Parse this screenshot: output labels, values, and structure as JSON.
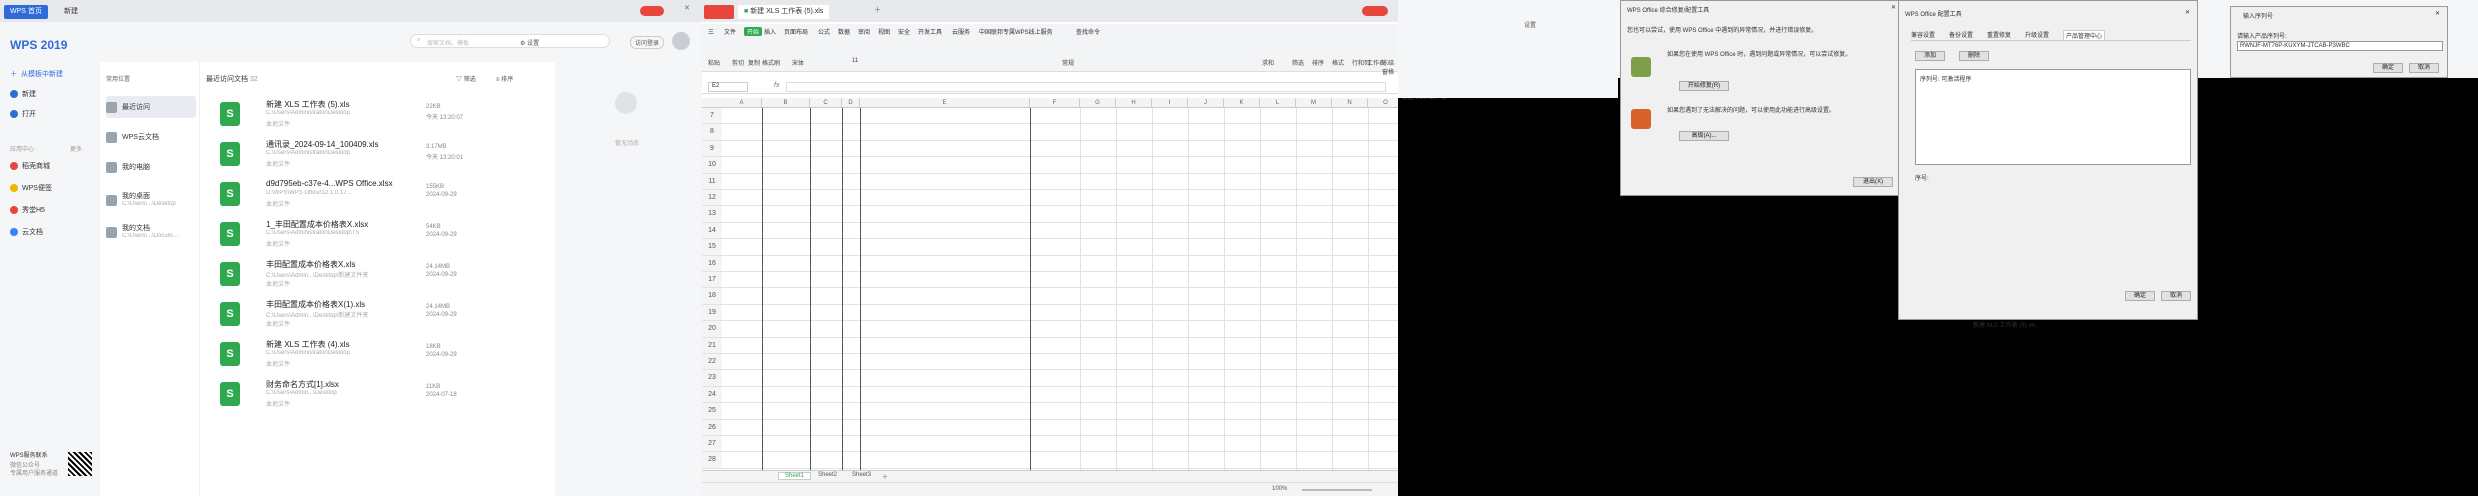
{
  "home": {
    "tabs": [
      "WPS 首页",
      "新建"
    ],
    "logo": "WPS 2019",
    "search_placeholder": "搜索文档、模板",
    "settings": "设置",
    "user_btn": "访问登录",
    "new_btn": "新建",
    "open_btn": "打开",
    "nav_top": "从模板中新建",
    "nav_label": "应用中心",
    "nav_more": "更多",
    "nav": [
      {
        "label": "稻壳商城",
        "color": "#e8453c"
      },
      {
        "label": "WPS便签",
        "color": "#f5b400"
      },
      {
        "label": "秀堂H5",
        "color": "#e8453c"
      },
      {
        "label": "云文档",
        "color": "#3b82f6"
      }
    ],
    "promo_title": "WPS服务联系",
    "promo_sub": "微信公众号",
    "promo_sub2": "专属用户服务通道",
    "mid_header": "常用位置",
    "mid_items": [
      "最近访问",
      "WPS云文档",
      "我的电脑",
      "我的桌面",
      "我的文档"
    ],
    "mid_sub": [
      "",
      "",
      "",
      "C:\\Users\\...\\Desktop",
      "C:\\Users\\...\\Documents"
    ],
    "list_header": "最近访问文档",
    "list_count": "32",
    "tool_filter": "筛选",
    "tool_sort": "排序",
    "empty_text": "暂无动态",
    "files": [
      {
        "name": "新建 XLS 工作表 (5).xls",
        "path": "C:\\Users\\Administrator\\Desktop",
        "meta": "本地文件",
        "size": "22KB",
        "date": "今天 13:20:07"
      },
      {
        "name": "通讯录_2024-09-14_100409.xls",
        "path": "C:\\Users\\Administrator\\Desktop",
        "meta": "本地文件",
        "size": "3.17MB",
        "date": "今天 13:20:01"
      },
      {
        "name": "d9d795eb-c37e-4...WPS Office.xlsx",
        "path": "D:\\WPS\\WPS Office\\12.1.0.17...",
        "meta": "本地文件",
        "size": "155KB",
        "date": "2024-09-29"
      },
      {
        "name": "1_丰田配置成本价格表X.xlsx",
        "path": "C:\\Users\\Administrator\\Desktop\\TS",
        "meta": "本地文件",
        "size": "54KB",
        "date": "2024-09-29"
      },
      {
        "name": "丰田配置成本价格表X.xls",
        "path": "C:\\Users\\Admin...\\Desktop\\新建文件夹",
        "meta": "本地文件",
        "size": "24.14MB",
        "date": "2024-09-29"
      },
      {
        "name": "丰田配置成本价格表X(1).xls",
        "path": "C:\\Users\\Admin...\\Desktop\\新建文件夹",
        "meta": "本地文件",
        "size": "24.14MB",
        "date": "2024-09-29"
      },
      {
        "name": "新建 XLS 工作表 (4).xls",
        "path": "C:\\Users\\Administrator\\Desktop",
        "meta": "本地文件",
        "size": "18KB",
        "date": "2024-09-29"
      },
      {
        "name": "财务命名方式[1].xlsx",
        "path": "C:\\Users\\Admin...\\Desktop",
        "meta": "本地文件",
        "size": "11KB",
        "date": "2024-07-18"
      }
    ]
  },
  "sheet": {
    "tabs": [
      "新建 XLS 工作表 (5).xls"
    ],
    "menu": [
      "三",
      "文件",
      "开始",
      "插入",
      "页面布局",
      "公式",
      "数据",
      "审阅",
      "视图",
      "安全",
      "开发工具",
      "云服务",
      "中国联邦专属WPS线上服务",
      "查找命令"
    ],
    "ribbon_groups": [
      "粘贴",
      "剪切",
      "复制",
      "格式刷",
      "宋体",
      "11",
      "常规",
      "求和",
      "筛选",
      "排序",
      "格式",
      "行和列",
      "工作表",
      "冻结窗格"
    ],
    "name_box": "E2",
    "fx": "fx",
    "columns": [
      "A",
      "B",
      "C",
      "D",
      "E",
      "F",
      "G",
      "H",
      "I",
      "J",
      "K",
      "L",
      "M",
      "N",
      "O"
    ],
    "rows": [
      "7",
      "8",
      "9",
      "10",
      "11",
      "12",
      "13",
      "14",
      "15",
      "16",
      "17",
      "18",
      "19",
      "20",
      "21",
      "22",
      "23",
      "24",
      "25",
      "26",
      "27",
      "28"
    ],
    "sheets": [
      "Sheet1",
      "Sheet2",
      "Sheet3"
    ],
    "zoom": "100%"
  },
  "dialogs": {
    "bg_title": "新建 XLS 工作表",
    "bg_settings": "设置",
    "repair": {
      "title": "WPS Office 综合修复/配置工具",
      "intro": "您也可以尝试，使用 WPS Office 中遇到的异常情况，并进行错误修复。",
      "text1": "如果您在使用 WPS Office 时，遇到问题或异常情况，可以尝试修复。",
      "btn1": "开始修复(R)",
      "text2": "如果您遇到了无法解决的问题，可以使用此功能进行高级设置。",
      "btn2": "高级(A)...",
      "exit": "退出(X)"
    },
    "config": {
      "title": "WPS Office 配置工具",
      "tabs": [
        "兼容设置",
        "备份设置",
        "重置修复",
        "升级设置",
        "产品管理中心"
      ],
      "add": "添加",
      "delete": "删除",
      "list_head": "序列号: 可激活程序",
      "label": "序号:",
      "ok": "确定",
      "cancel": "取消"
    },
    "serial": {
      "title": "输入序列号",
      "label": "请输入产品序列号:",
      "value": "RWNJF-MT76P-KUXYM-JTCAB-P3WBC",
      "ok": "确定",
      "cancel": "取消"
    },
    "bottom_text": "新建 XLS 工作表 (5).xls"
  }
}
